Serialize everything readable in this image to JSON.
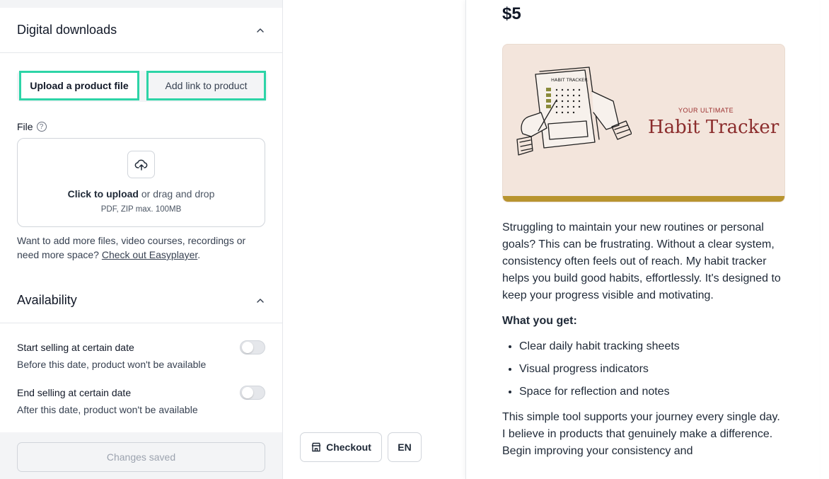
{
  "downloads": {
    "title": "Digital downloads",
    "tabs": [
      "Upload a product file",
      "Add link to product"
    ],
    "file_label": "File",
    "help_glyph": "?",
    "dropzone": {
      "click_text": "Click to upload",
      "rest_text": " or drag and drop",
      "formats": "PDF, ZIP max. 100MB"
    },
    "more_text": "Want to add more files, video courses, recordings or need more space? ",
    "more_link": "Check out Easyplayer",
    "more_end": "."
  },
  "availability": {
    "title": "Availability",
    "start": {
      "title": "Start selling at certain date",
      "subtitle": "Before this date, product won't be available",
      "enabled": false
    },
    "end": {
      "title": "End selling at certain date",
      "subtitle": "After this date, product won't be available",
      "enabled": false
    }
  },
  "save_label": "Changes saved",
  "preview_controls": {
    "checkout": "Checkout",
    "language": "EN"
  },
  "preview": {
    "price": "$5",
    "hero_small": "YOUR ULTIMATE",
    "hero_big": "Habit Tracker",
    "hero_sheet_title": "HABIT TRACKER",
    "intro": "Struggling to maintain your new routines or personal goals? This can be frustrating. Without a clear system, consistency often feels out of reach. My habit tracker helps you build good habits, effortlessly. It's designed to keep your progress visible and motivating.",
    "what_you_get": "What you get:",
    "bullets": [
      "Clear daily habit tracking sheets",
      "Visual progress indicators",
      "Space for reflection and notes"
    ],
    "outro": "This simple tool supports your journey every single day. I believe in products that genuinely make a difference. Begin improving your consistency and"
  },
  "colors": {
    "accent_outline": "#2dd4a7",
    "hero_bg": "#f3e5dc",
    "hero_text": "#8b2c2c",
    "hero_bar": "#b8942f"
  }
}
